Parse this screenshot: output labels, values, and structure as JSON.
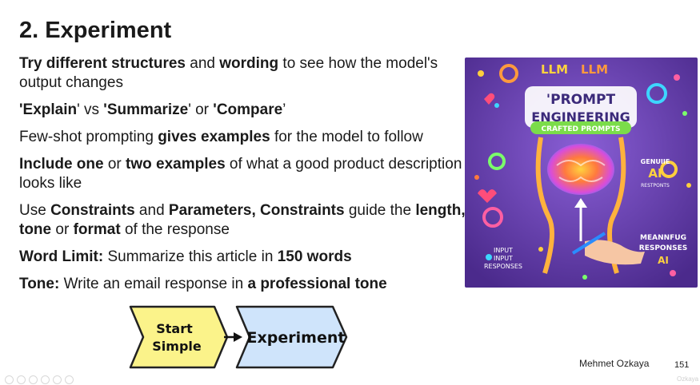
{
  "slide": {
    "title": "2. Experiment",
    "bullets": [
      {
        "parts": [
          {
            "t": "Try different structures",
            "b": true
          },
          {
            "t": " and ",
            "b": false
          },
          {
            "t": "wording",
            "b": true
          },
          {
            "t": " to see how the model's output changes",
            "b": false
          }
        ]
      },
      {
        "parts": [
          {
            "t": "'Explain",
            "b": true
          },
          {
            "t": "' vs ",
            "b": false
          },
          {
            "t": "'Summarize",
            "b": true
          },
          {
            "t": "' or ",
            "b": false
          },
          {
            "t": "'Compare",
            "b": true
          },
          {
            "t": "’",
            "b": false
          }
        ]
      },
      {
        "parts": [
          {
            "t": "Few-shot prompting ",
            "b": false
          },
          {
            "t": "gives examples",
            "b": true
          },
          {
            "t": " for the model to follow",
            "b": false
          }
        ]
      },
      {
        "parts": [
          {
            "t": "Include one",
            "b": true
          },
          {
            "t": " or ",
            "b": false
          },
          {
            "t": "two examples",
            "b": true
          },
          {
            "t": " of what a good product description looks like",
            "b": false
          }
        ]
      },
      {
        "parts": [
          {
            "t": "Use ",
            "b": false
          },
          {
            "t": "Constraints",
            "b": true
          },
          {
            "t": " and ",
            "b": false
          },
          {
            "t": "Parameters, Constraints",
            "b": true
          },
          {
            "t": " guide the ",
            "b": false
          },
          {
            "t": "length, tone",
            "b": true
          },
          {
            "t": " or ",
            "b": false
          },
          {
            "t": "format",
            "b": true
          },
          {
            "t": " of the response",
            "b": false
          }
        ]
      },
      {
        "parts": [
          {
            "t": "Word Limit:",
            "b": true
          },
          {
            "t": " Summarize this article in ",
            "b": false
          },
          {
            "t": "150 words",
            "b": true
          }
        ]
      },
      {
        "parts": [
          {
            "t": "Tone:",
            "b": true
          },
          {
            "t": " Write an email response in ",
            "b": false
          },
          {
            "t": "a professional tone",
            "b": true
          }
        ]
      }
    ],
    "flow": {
      "step1_line1": "Start",
      "step1_line2": "Simple",
      "step2": "Experiment",
      "step1_color": "#fbf38a",
      "step2_color": "#cfe4fb"
    },
    "author": "Mehmet Ozkaya",
    "page_number": "151",
    "watermark": "Ozkaya"
  },
  "illustration": {
    "logo_left": "LLM",
    "logo_right": "LLM",
    "title_line1": "'PROMPT",
    "title_line2": "ENGINEERING",
    "subtitle": "CRAFTED   PROMPTS",
    "right_label1": "GENUIIE",
    "right_label2": "AI",
    "right_label3": "RESTPONTS",
    "right_bottom1": "MEANNFUG",
    "right_bottom2": "RESPONSES",
    "right_bottom3": "AI",
    "left_bottom1": "INPUT",
    "left_bottom2": "INPUT",
    "left_bottom3": "RESPONSES",
    "bg_color": "#6a3fae"
  },
  "playback_icons": [
    "rewind-icon",
    "previous-icon",
    "play-icon",
    "next-icon",
    "fullscreen-icon",
    "zoom-icon"
  ]
}
